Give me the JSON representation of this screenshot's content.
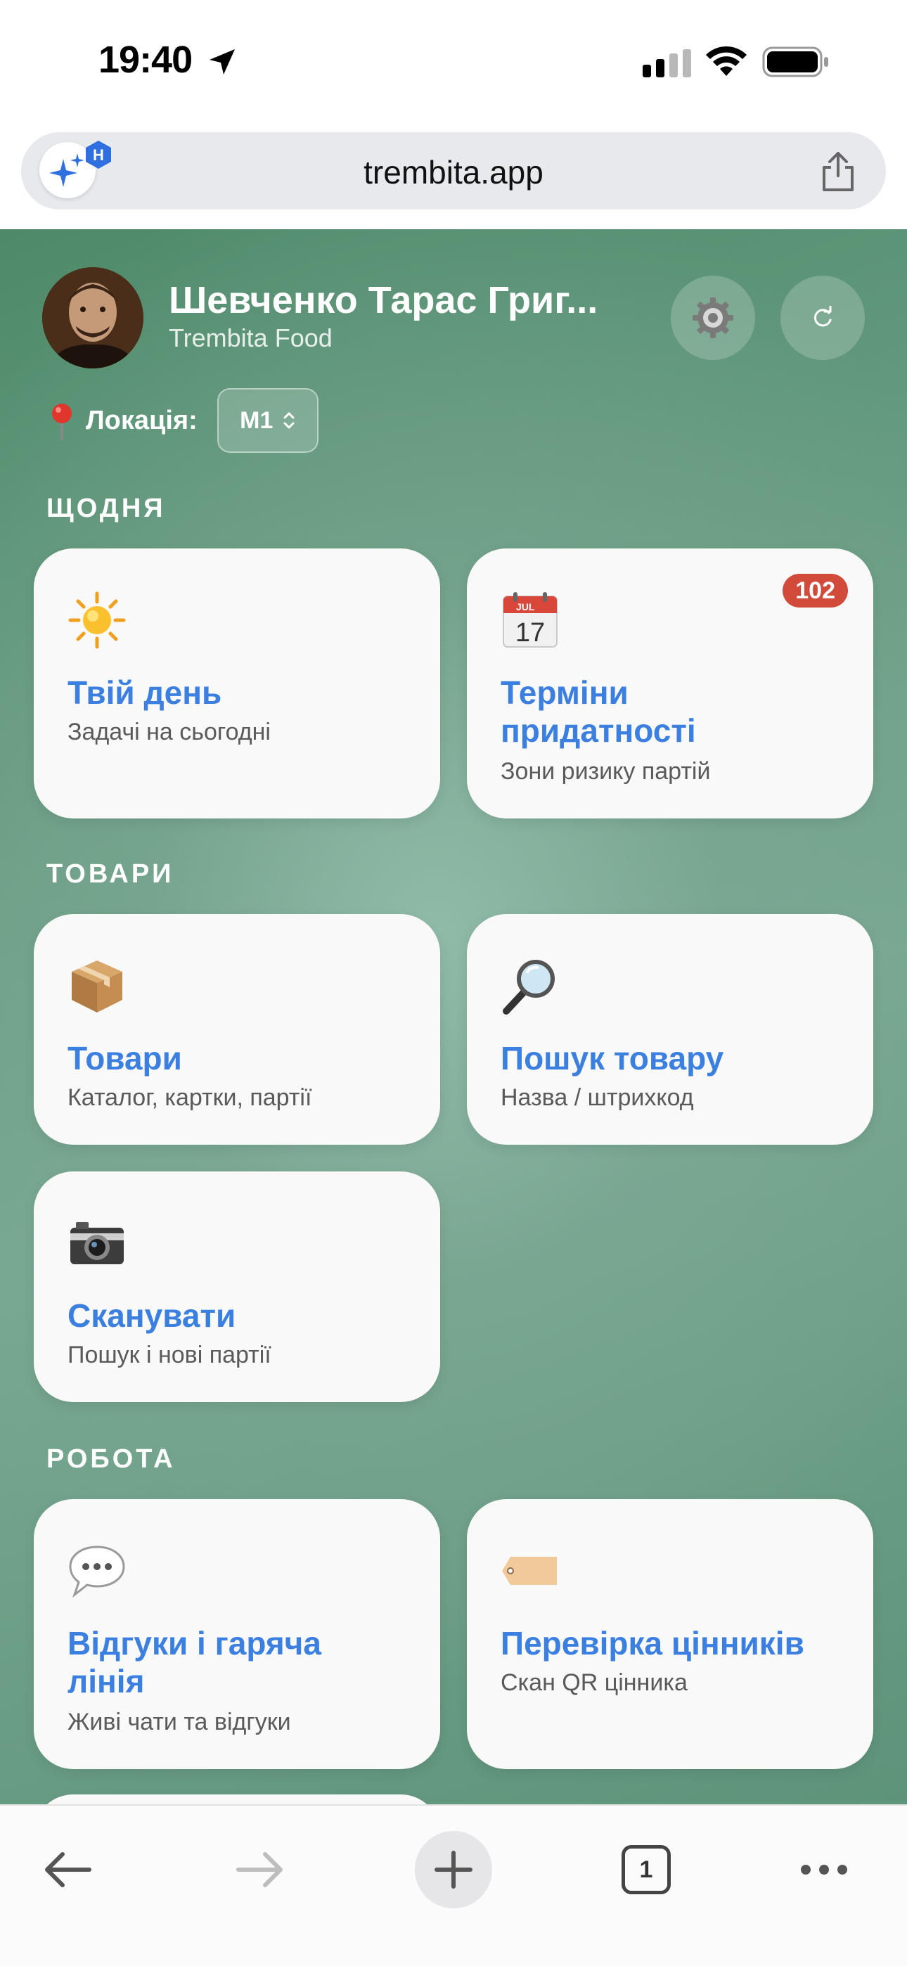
{
  "status_bar": {
    "time": "19:40"
  },
  "browser": {
    "url": "trembita.app",
    "ai_badge": "H"
  },
  "header": {
    "user_name": "Шевченко Тарас Григ...",
    "company": "Trembita Food",
    "location_label": "Локація:",
    "location_value": "M1"
  },
  "sections": {
    "daily": "ЩОДНЯ",
    "goods": "ТОВАРИ",
    "work": "РОБОТА"
  },
  "cards": {
    "your_day": {
      "icon": "sun-icon",
      "title": "Твій день",
      "subtitle": "Задачі на сьогодні"
    },
    "expiry": {
      "icon": "calendar-icon",
      "title_line1": "Терміни",
      "title_line2": "придатності",
      "subtitle": "Зони ризику партій",
      "badge": "102",
      "calendar_month": "JUL",
      "calendar_day": "17"
    },
    "goods": {
      "icon": "package-icon",
      "title": "Товари",
      "subtitle": "Каталог, картки, партії"
    },
    "search": {
      "icon": "magnifier-icon",
      "title": "Пошук товару",
      "subtitle": "Назва / штрихкод"
    },
    "scan": {
      "icon": "camera-icon",
      "title": "Сканувати",
      "subtitle": "Пошук і нові партії"
    },
    "feedback": {
      "icon": "speech-bubble-icon",
      "title_line1": "Відгуки і гаряча",
      "title_line2": "лінія",
      "subtitle": "Живі чати та відгуки"
    },
    "price_check": {
      "icon": "tag-icon",
      "title": "Перевірка цінників",
      "subtitle": "Скан QR цінника"
    }
  },
  "toolbar": {
    "tab_count": "1"
  },
  "colors": {
    "accent": "#3b7fe0",
    "badge": "#d24a3a",
    "background_green": "#6a9e84"
  }
}
